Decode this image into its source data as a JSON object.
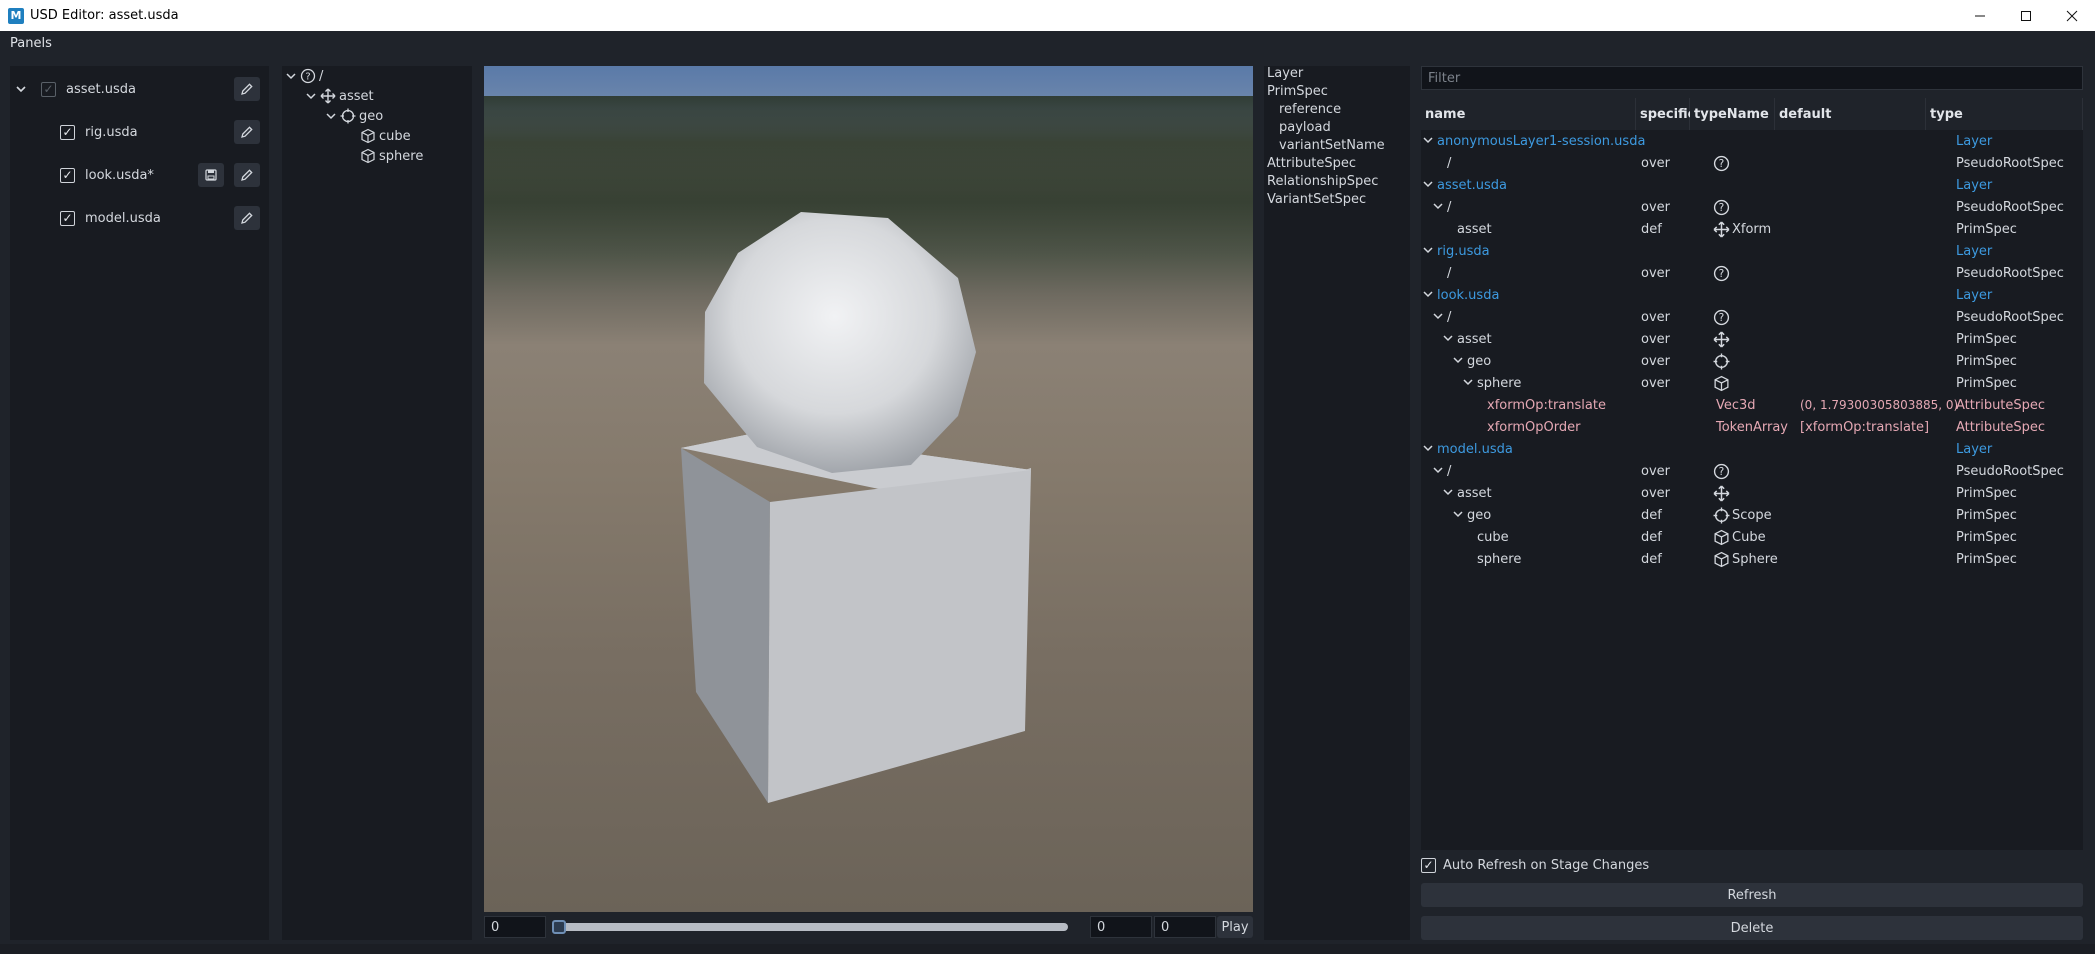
{
  "window": {
    "title": "USD Editor: asset.usda",
    "logo_letter": "M"
  },
  "menu": {
    "panels_label": "Panels"
  },
  "layers": [
    {
      "name": "asset.usda",
      "checked": true,
      "save": false
    },
    {
      "name": "rig.usda",
      "checked": true,
      "save": false
    },
    {
      "name": "look.usda*",
      "checked": true,
      "save": true
    },
    {
      "name": "model.usda",
      "checked": true,
      "save": false
    }
  ],
  "prim_tree": {
    "root": "/",
    "asset": "asset",
    "geo": "geo",
    "cube": "cube",
    "sphere": "sphere"
  },
  "timeline": {
    "start": "0",
    "current": "0",
    "end": "0",
    "play_label": "Play"
  },
  "spec_types": {
    "layer": "Layer",
    "primspec": "PrimSpec",
    "reference": "reference",
    "payload": "payload",
    "variantsetname": "variantSetName",
    "attributespec": "AttributeSpec",
    "relationshipspec": "RelationshipSpec",
    "variantsetspec": "VariantSetSpec"
  },
  "filter": {
    "placeholder": "Filter"
  },
  "table": {
    "headers": {
      "name": "name",
      "specifier": "specifier",
      "typeName": "typeName",
      "default": "default",
      "type": "type"
    },
    "rows": [
      {
        "name": "anonymousLayer1-session.usda",
        "specifier": "",
        "typeName": "",
        "default": "",
        "type": "Layer"
      },
      {
        "name": "/",
        "specifier": "over",
        "typeName": "",
        "default": "",
        "type": "PseudoRootSpec"
      },
      {
        "name": "asset.usda",
        "specifier": "",
        "typeName": "",
        "default": "",
        "type": "Layer"
      },
      {
        "name": "/",
        "specifier": "over",
        "typeName": "",
        "default": "",
        "type": "PseudoRootSpec"
      },
      {
        "name": "asset",
        "specifier": "def",
        "typeName": "Xform",
        "default": "",
        "type": "PrimSpec"
      },
      {
        "name": "rig.usda",
        "specifier": "",
        "typeName": "",
        "default": "",
        "type": "Layer"
      },
      {
        "name": "/",
        "specifier": "over",
        "typeName": "",
        "default": "",
        "type": "PseudoRootSpec"
      },
      {
        "name": "look.usda",
        "specifier": "",
        "typeName": "",
        "default": "",
        "type": "Layer"
      },
      {
        "name": "/",
        "specifier": "over",
        "typeName": "",
        "default": "",
        "type": "PseudoRootSpec"
      },
      {
        "name": "asset",
        "specifier": "over",
        "typeName": "",
        "default": "",
        "type": "PrimSpec"
      },
      {
        "name": "geo",
        "specifier": "over",
        "typeName": "",
        "default": "",
        "type": "PrimSpec"
      },
      {
        "name": "sphere",
        "specifier": "over",
        "typeName": "",
        "default": "",
        "type": "PrimSpec"
      },
      {
        "name": "xformOp:translate",
        "specifier": "",
        "typeName": "Vec3d",
        "default": "(0, 1.79300305803885, 0)",
        "type": "AttributeSpec"
      },
      {
        "name": "xformOpOrder",
        "specifier": "",
        "typeName": "TokenArray",
        "default": "[xformOp:translate]",
        "type": "AttributeSpec"
      },
      {
        "name": "model.usda",
        "specifier": "",
        "typeName": "",
        "default": "",
        "type": "Layer"
      },
      {
        "name": "/",
        "specifier": "over",
        "typeName": "",
        "default": "",
        "type": "PseudoRootSpec"
      },
      {
        "name": "asset",
        "specifier": "over",
        "typeName": "",
        "default": "",
        "type": "PrimSpec"
      },
      {
        "name": "geo",
        "specifier": "def",
        "typeName": "Scope",
        "default": "",
        "type": "PrimSpec"
      },
      {
        "name": "cube",
        "specifier": "def",
        "typeName": "Cube",
        "default": "",
        "type": "PrimSpec"
      },
      {
        "name": "sphere",
        "specifier": "def",
        "typeName": "Sphere",
        "default": "",
        "type": "PrimSpec"
      }
    ]
  },
  "auto_refresh": {
    "label": "Auto Refresh on Stage Changes",
    "checked": true
  },
  "buttons": {
    "refresh": "Refresh",
    "delete": "Delete"
  },
  "colors": {
    "accent_blue": "#3d9ae0",
    "attribute_pink": "#e5a8b4",
    "panel_bg": "#181b21"
  }
}
